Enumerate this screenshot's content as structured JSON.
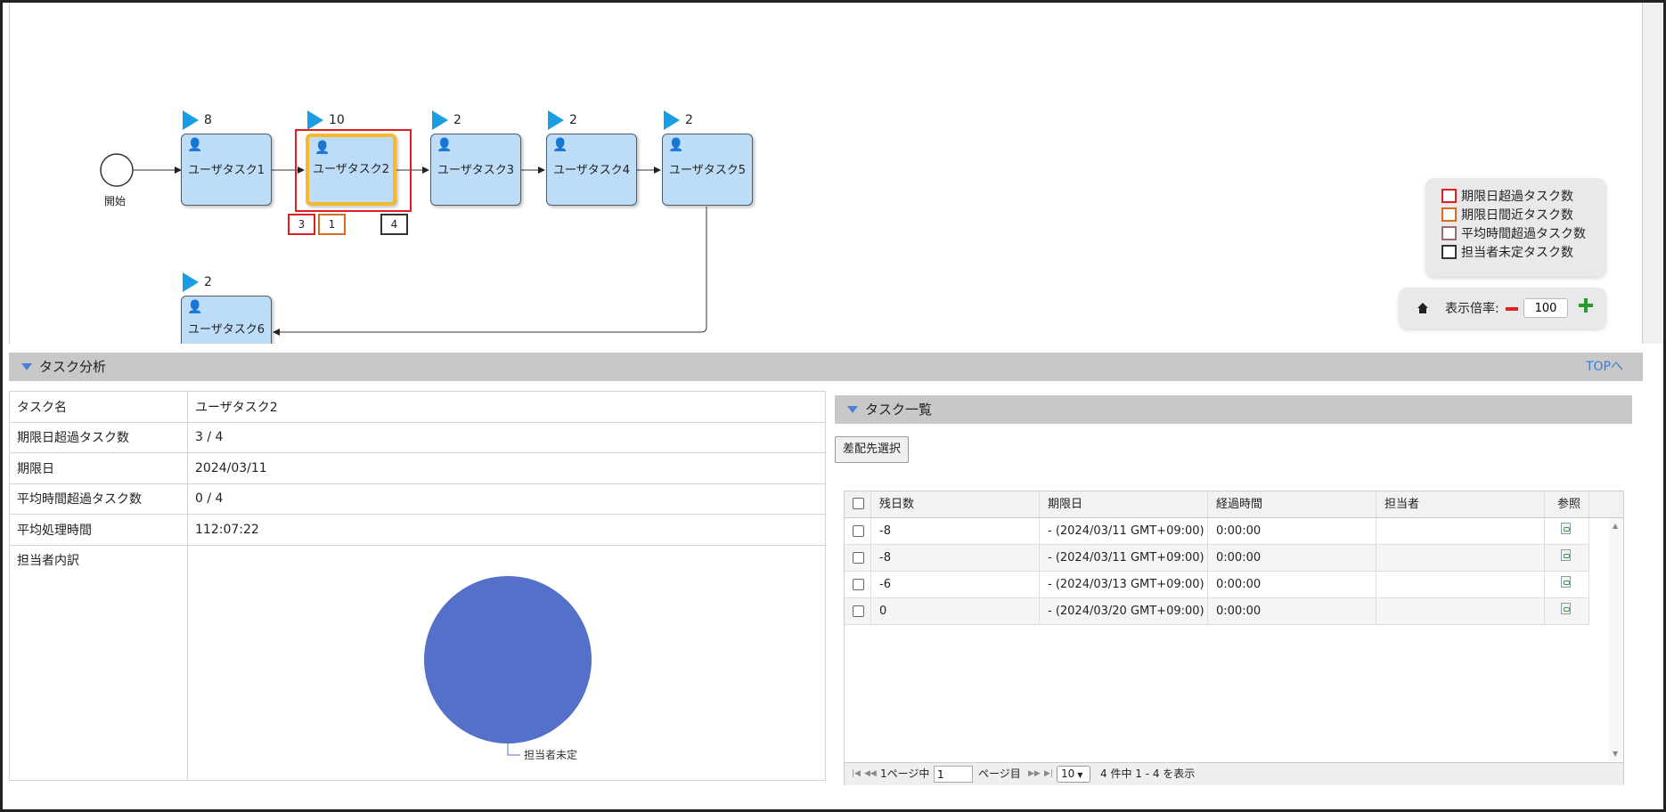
{
  "diagram": {
    "start_label": "開始",
    "tasks": [
      {
        "label": "ユーザタスク1",
        "count": "8"
      },
      {
        "label": "ユーザタスク2",
        "count": "10"
      },
      {
        "label": "ユーザタスク3",
        "count": "2"
      },
      {
        "label": "ユーザタスク4",
        "count": "2"
      },
      {
        "label": "ユーザタスク5",
        "count": "2"
      },
      {
        "label": "ユーザタスク6",
        "count": "2"
      }
    ],
    "badges": {
      "overdue": "3",
      "near": "1",
      "unassigned": "4"
    },
    "colors": {
      "task_fill": "#bddcf8",
      "selected_outline": "#f5b82e",
      "selection_box": "#e01e1e",
      "flag": "#1a9de2"
    }
  },
  "legend": {
    "items": [
      {
        "label": "期限日超過タスク数",
        "color": "#e01e1e"
      },
      {
        "label": "期限日間近タスク数",
        "color": "#d96b1c"
      },
      {
        "label": "平均時間超過タスク数",
        "color": "#9a6b70"
      },
      {
        "label": "担当者未定タスク数",
        "color": "#333333"
      }
    ]
  },
  "zoom": {
    "label": "表示倍率:",
    "value": "100",
    "home_icon": "home-icon",
    "minus_icon": "minus-icon",
    "plus_icon": "plus-icon"
  },
  "analysis": {
    "title": "タスク分析",
    "top_link": "TOPへ",
    "rows": [
      {
        "key": "タスク名",
        "value": "ユーザタスク2"
      },
      {
        "key": "期限日超過タスク数",
        "value": "3 / 4"
      },
      {
        "key": "期限日",
        "value": "2024/03/11"
      },
      {
        "key": "平均時間超過タスク数",
        "value": "0 / 4"
      },
      {
        "key": "平均処理時間",
        "value": "112:07:22"
      }
    ],
    "breakdown_key": "担当者内訳"
  },
  "chart_data": {
    "type": "pie",
    "categories": [
      "担当者未定"
    ],
    "values": [
      4
    ],
    "colors": [
      "#5570c8"
    ]
  },
  "task_list": {
    "title": "タスク一覧",
    "assign_button": "差配先選択",
    "columns": [
      "残日数",
      "期限日",
      "経過時間",
      "担当者",
      "参照"
    ],
    "rows": [
      {
        "days": "-8",
        "due": "- (2024/03/11 GMT+09:00)",
        "elapsed": "0:00:00",
        "assignee": ""
      },
      {
        "days": "-8",
        "due": "- (2024/03/11 GMT+09:00)",
        "elapsed": "0:00:00",
        "assignee": ""
      },
      {
        "days": "-6",
        "due": "- (2024/03/13 GMT+09:00)",
        "elapsed": "0:00:00",
        "assignee": ""
      },
      {
        "days": "0",
        "due": "- (2024/03/20 GMT+09:00)",
        "elapsed": "0:00:00",
        "assignee": ""
      }
    ],
    "pager": {
      "page_prefix": "1ページ中",
      "page_value": "1",
      "page_suffix": "ページ目",
      "page_size": "10",
      "summary": "4 件中 1 - 4 を表示"
    }
  }
}
